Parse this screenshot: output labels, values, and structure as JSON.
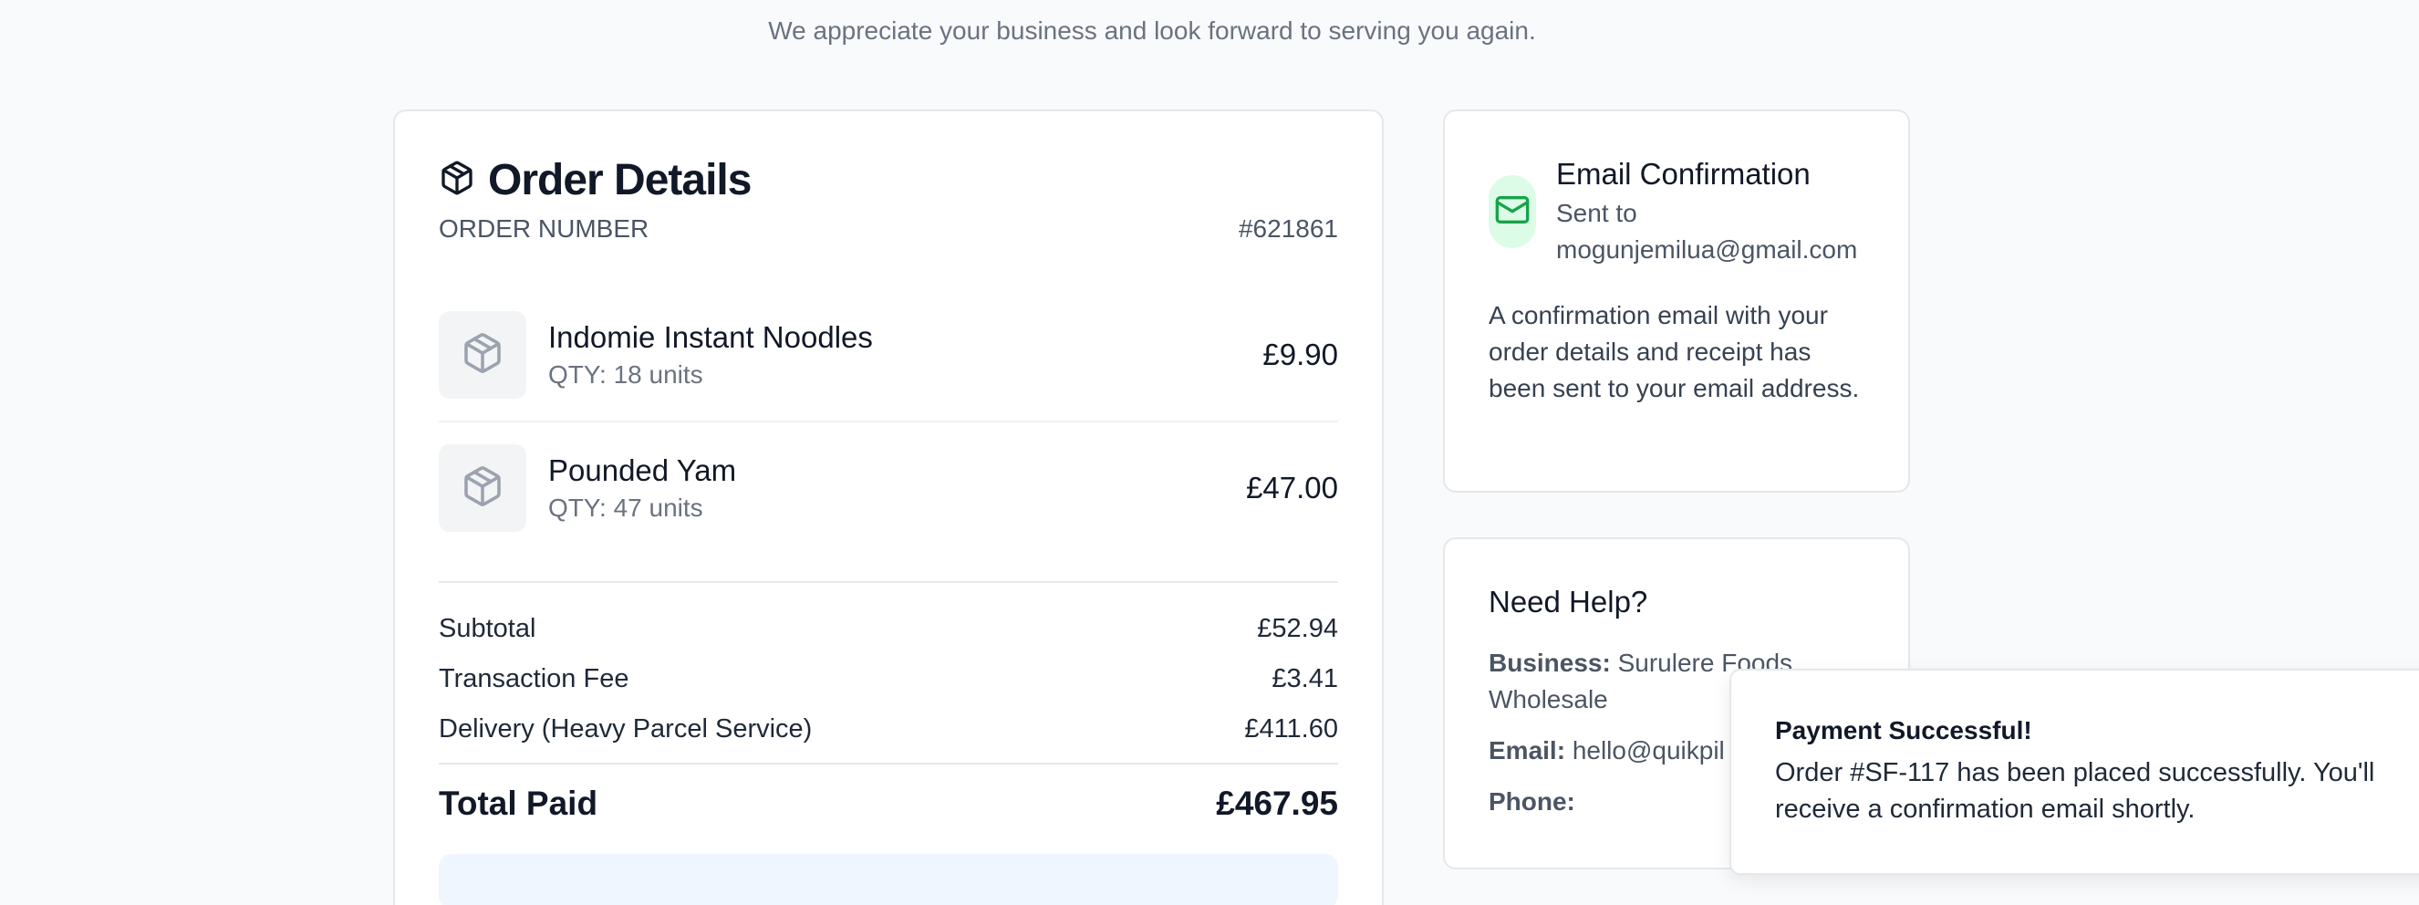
{
  "tagline": "We appreciate your business and look forward to serving you again.",
  "order": {
    "title": "Order Details",
    "number_label": "ORDER NUMBER",
    "number_value": "#621861",
    "items": [
      {
        "name": "Indomie Instant Noodles",
        "qty": "QTY: 18 units",
        "price": "£9.90",
        "icon": "package-icon"
      },
      {
        "name": "Pounded Yam",
        "qty": "QTY: 47 units",
        "price": "£47.00",
        "icon": "package-icon"
      }
    ],
    "totals": {
      "subtotal_label": "Subtotal",
      "subtotal_value": "£52.94",
      "fee_label": "Transaction Fee",
      "fee_value": "£3.41",
      "delivery_label": "Delivery (Heavy Parcel Service)",
      "delivery_value": "£411.60",
      "total_label": "Total Paid",
      "total_value": "£467.95"
    }
  },
  "email": {
    "icon": "mail-icon",
    "title": "Email Confirmation",
    "sent_to": "Sent to",
    "address": "mogunjemilua@gmail.com",
    "body": "A confirmation email with your order details and receipt has been sent to your email address."
  },
  "help": {
    "title": "Need Help?",
    "business_label": "Business:",
    "business_value": "Surulere Foods Wholesale",
    "email_label": "Email:",
    "email_value": "hello@quikpil",
    "phone_label": "Phone:"
  },
  "toast": {
    "title": "Payment Successful!",
    "message": "Order #SF-117 has been placed successfully. You'll receive a confirmation email shortly."
  },
  "colors": {
    "background": "#f9fafb",
    "success_tint": "#dcfce7",
    "success_icon": "#16a34a",
    "info_tint": "#eff6ff"
  }
}
